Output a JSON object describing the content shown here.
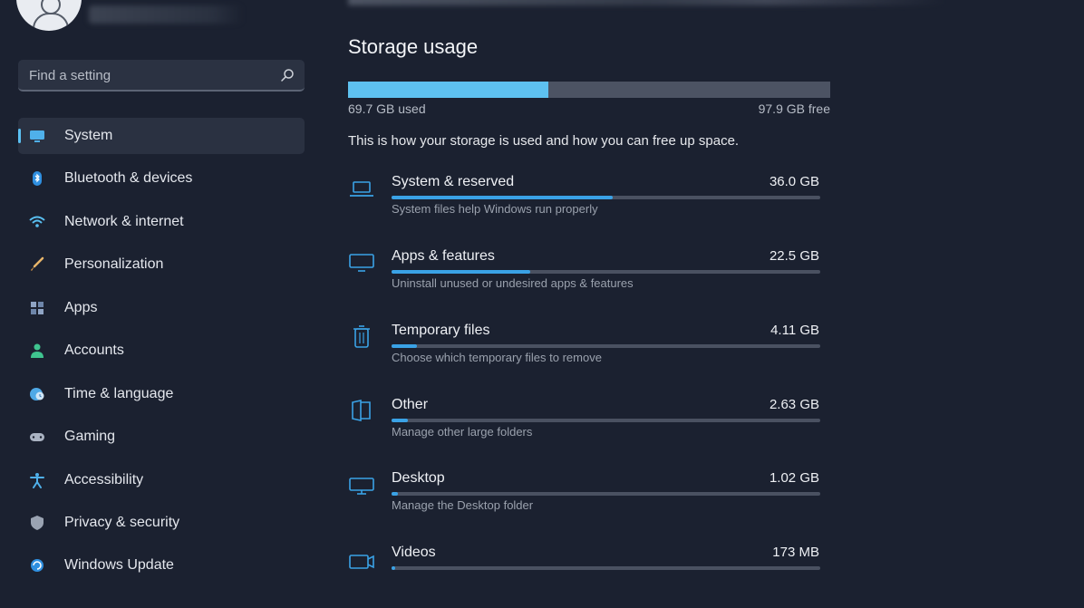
{
  "sidebar": {
    "search_placeholder": "Find a setting",
    "items": [
      {
        "label": "System",
        "icon": "monitor-icon",
        "active": true
      },
      {
        "label": "Bluetooth & devices",
        "icon": "bluetooth-icon"
      },
      {
        "label": "Network & internet",
        "icon": "wifi-icon"
      },
      {
        "label": "Personalization",
        "icon": "brush-icon"
      },
      {
        "label": "Apps",
        "icon": "apps-icon"
      },
      {
        "label": "Accounts",
        "icon": "person-icon"
      },
      {
        "label": "Time & language",
        "icon": "globe-clock-icon"
      },
      {
        "label": "Gaming",
        "icon": "gamepad-icon"
      },
      {
        "label": "Accessibility",
        "icon": "accessibility-icon"
      },
      {
        "label": "Privacy & security",
        "icon": "shield-icon"
      },
      {
        "label": "Windows Update",
        "icon": "update-icon"
      }
    ]
  },
  "storage": {
    "title": "Storage usage",
    "used_label": "69.7 GB used",
    "free_label": "97.9 GB free",
    "used_fraction": 0.416,
    "description": "This is how your storage is used and how you can free up space.",
    "categories": [
      {
        "name": "System & reserved",
        "size": "36.0 GB",
        "subtitle": "System files help Windows run properly",
        "fraction": 0.516,
        "icon": "laptop-icon"
      },
      {
        "name": "Apps & features",
        "size": "22.5 GB",
        "subtitle": "Uninstall unused or undesired apps & features",
        "fraction": 0.323,
        "icon": "monitor-icon"
      },
      {
        "name": "Temporary files",
        "size": "4.11 GB",
        "subtitle": "Choose which temporary files to remove",
        "fraction": 0.059,
        "icon": "trash-icon"
      },
      {
        "name": "Other",
        "size": "2.63 GB",
        "subtitle": "Manage other large folders",
        "fraction": 0.038,
        "icon": "folder-icon"
      },
      {
        "name": "Desktop",
        "size": "1.02 GB",
        "subtitle": "Manage the Desktop folder",
        "fraction": 0.015,
        "icon": "desktop-icon"
      },
      {
        "name": "Videos",
        "size": "173 MB",
        "subtitle": "",
        "fraction": 0.0025,
        "icon": "video-icon"
      }
    ]
  },
  "colors": {
    "accent": "#5ec1f0",
    "bar_fill": "#3aa2e6",
    "background": "#1b2130"
  }
}
